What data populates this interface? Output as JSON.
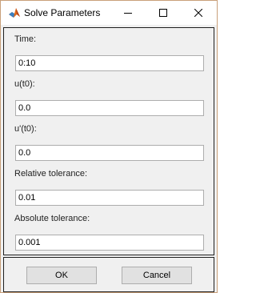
{
  "window": {
    "title": "Solve Parameters",
    "icon": "matlab-icon"
  },
  "fields": [
    {
      "label": "Time:",
      "value": "0:10"
    },
    {
      "label": "u(t0):",
      "value": "0.0"
    },
    {
      "label": "u'(t0):",
      "value": "0.0"
    },
    {
      "label": "Relative tolerance:",
      "value": "0.01"
    },
    {
      "label": "Absolute tolerance:",
      "value": "0.001"
    }
  ],
  "buttons": {
    "ok": "OK",
    "cancel": "Cancel"
  }
}
